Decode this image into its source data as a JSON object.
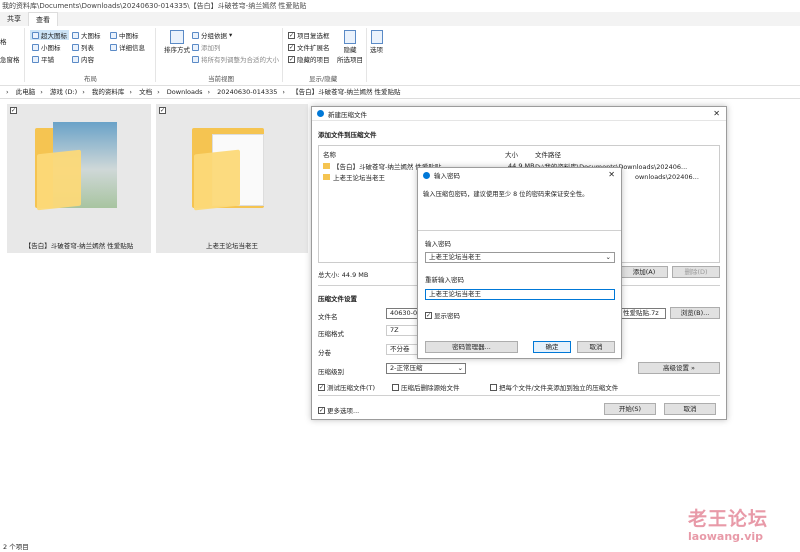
{
  "title_path": "我的资料库\\Documents\\Downloads\\20240630-014335\\【告白】斗破苍穹-纳兰嫣然 性爱贴贴",
  "tabs": [
    "共享",
    "查看"
  ],
  "ribbon": {
    "left_labels": [
      "格",
      "急窗格"
    ],
    "layout": {
      "items": [
        "超大图标",
        "大图标",
        "中图标",
        "小图标",
        "列表",
        "详细信息",
        "平铺",
        "内容"
      ],
      "label": "布局"
    },
    "view": {
      "sort": "排序方式",
      "group": "分组依据",
      "add_col": "添加列",
      "fit_cols": "将所有列调整为合适的大小",
      "label": "当前视图"
    },
    "show": {
      "checks": [
        "项目复选框",
        "文件扩展名",
        "隐藏的项目"
      ],
      "hide": "隐藏",
      "hide_sel": "所选项目",
      "label": "显示/隐藏"
    },
    "options": "选项"
  },
  "breadcrumb": [
    "此电脑",
    "游戏 (D:)",
    "我的资料库",
    "文档",
    "Downloads",
    "20240630-014335",
    "【告白】斗破苍穹-纳兰嫣然 性爱贴贴"
  ],
  "folders": [
    {
      "name": "【告白】斗破苍穹-纳兰嫣然 性爱贴贴"
    },
    {
      "name": "上老王论坛当老王"
    }
  ],
  "status": "2 个项目",
  "archive_dialog": {
    "title": "新建压缩文件",
    "section_add": "添加文件到压缩文件",
    "col_name": "名称",
    "col_size": "大小",
    "col_path": "文件路径",
    "rows": [
      {
        "name": "【告白】斗破苍穹-纳兰嫣然 性爱贴贴",
        "size": "44.9 MB",
        "path": "D:\\我的资料库\\Documents\\Downloads\\202406..."
      },
      {
        "name": "上老王论坛当老王",
        "size": "",
        "path": "ownloads\\202406..."
      }
    ],
    "total": "总大小: 44.9 MB",
    "add_btn": "添加(A)",
    "del_btn": "删除(D)",
    "section_settings": "压缩文件设置",
    "filename_label": "文件名",
    "filename_value": "40630-01",
    "filename_tail": "性爱贴贴.7z",
    "browse_btn": "浏览(B)...",
    "format_label": "压缩格式",
    "format_value": "7Z",
    "split_label": "分卷",
    "split_value": "不分卷",
    "level_label": "压缩级别",
    "level_value": "2-正常压缩",
    "advanced_btn": "高级设置 »",
    "opt_test": "测试压缩文件(T)",
    "opt_delete": "压缩后删除源始文件",
    "opt_separate": "把每个文件/文件夹添加到独立的压缩文件",
    "more_opts": "更多选项...",
    "start_btn": "开始(S)",
    "cancel_btn": "取消"
  },
  "password_dialog": {
    "title": "输入密码",
    "hint": "输入压缩包密码，建议使用至少 8 位的密码来保证安全性。",
    "pw_label": "输入密码",
    "pw_value": "上老王论坛当老王",
    "re_label": "重新输入密码",
    "re_value": "上老王论坛当老王",
    "show_pw": "显示密码",
    "manager_btn": "密码管理器...",
    "ok_btn": "确定",
    "cancel_btn": "取消"
  },
  "watermark": {
    "cn": "老王论坛",
    "en": "laowang.vip"
  },
  "colors": {
    "accent": "#0078d7",
    "watermark": "#e89aa8",
    "folder": "#f5c451"
  }
}
